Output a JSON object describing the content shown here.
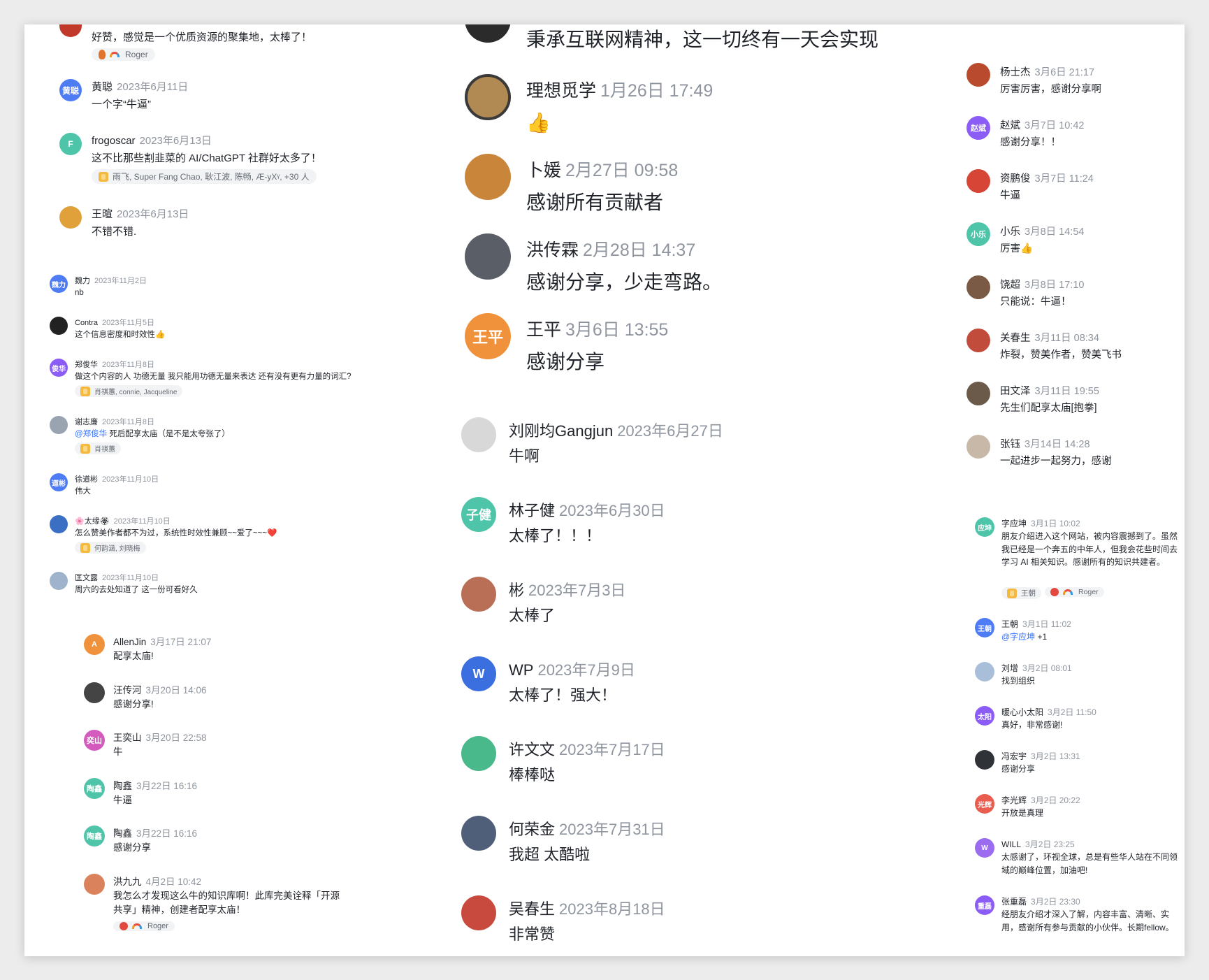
{
  "colors": {
    "blue": "#4e7cf5",
    "teal": "#4ec5a8",
    "orange": "#f0923c",
    "purple": "#8b5cf6",
    "pink": "#d45bbd",
    "red": "#e85d4e",
    "dark": "#2b2b2b",
    "mention": "#3370ff"
  },
  "left": {
    "c1": {
      "name": "",
      "date": "",
      "text": "好赞，感觉是一个优质资源的聚集地，太棒了！",
      "react": "Roger"
    },
    "c2": {
      "avatar": "黄聪",
      "name": "黄聪",
      "date": "2023年6月11日",
      "text": "一个字“牛逼”"
    },
    "c3": {
      "avatar": "F",
      "name": "frogoscar",
      "date": "2023年6月13日",
      "text": "这不比那些割韭菜的 AI/ChatGPT 社群好太多了！",
      "react": "雨飞, Super Fang Chao, 耿江波, 陈畅, Æ-yXᵞ, +30 人"
    },
    "c4": {
      "avatar": "",
      "name": "王暄",
      "date": "2023年6月13日",
      "text": "不错不错."
    },
    "d1": {
      "avatar": "魏力",
      "name": "魏力",
      "date": "2023年11月2日",
      "text": "nb"
    },
    "d2": {
      "avatar": "",
      "name": "Contra",
      "date": "2023年11月5日",
      "text": "这个信息密度和时效性"
    },
    "d3": {
      "avatar": "俊华",
      "name": "郑俊华",
      "date": "2023年11月8日",
      "text": "做这个内容的人 功德无量  我只能用功德无量来表达  还有没有更有力量的词汇?",
      "react": "肖祺蕙, connie, Jacqueline"
    },
    "d4": {
      "avatar": "",
      "name": "谢志廉",
      "date": "2023年11月8日",
      "mention": "@郑俊华",
      "text": "死后配享太庙（是不是太夸张了）",
      "react": "肖祺蕙"
    },
    "d5": {
      "avatar": "道彬",
      "name": "徐道彬",
      "date": "2023年11月10日",
      "text": "伟大"
    },
    "d6": {
      "avatar": "",
      "name": "🌸太缘🏵",
      "date": "2023年11月10日",
      "text": "怎么赞美作者都不为过，系统性时效性兼顾~~爱了~~~❤️",
      "react": "何韵涵, 刘晓梅"
    },
    "d7": {
      "avatar": "",
      "name": "匡文露",
      "date": "2023年11月10日",
      "text": "周六的去处知道了 这一份可看好久"
    },
    "e1": {
      "avatar": "A",
      "name": "AllenJin",
      "date": "3月17日 21:07",
      "text": "配享太庙!"
    },
    "e2": {
      "avatar": "",
      "name": "汪传河",
      "date": "3月20日 14:06",
      "text": "感谢分享!"
    },
    "e3": {
      "avatar": "奕山",
      "name": "王奕山",
      "date": "3月20日 22:58",
      "text": "牛"
    },
    "e4": {
      "avatar": "陶鑫",
      "name": "陶鑫",
      "date": "3月22日 16:16",
      "text": "牛逼"
    },
    "e5": {
      "avatar": "陶鑫",
      "name": "陶鑫",
      "date": "3月22日 16:16",
      "text": "感谢分享"
    },
    "e6": {
      "avatar": "",
      "name": "洪九九",
      "date": "4月2日 10:42",
      "text": "我怎么才发现这么牛的知识库啊！此库完美诠释「开源共享」精神，创建者配享太庙！",
      "react": "Roger"
    }
  },
  "mid": {
    "top_text": "秉承互联网精神，这一切终有一天会实现",
    "m1": {
      "avatar": "",
      "name": "理想觅学",
      "date": "1月26日 17:49",
      "text": "👍"
    },
    "m2": {
      "avatar": "",
      "name": "卜媛",
      "date": "2月27日 09:58",
      "text": "感谢所有贡献者"
    },
    "m3": {
      "avatar": "",
      "name": "洪传霖",
      "date": "2月28日 14:37",
      "text": "感谢分享，少走弯路。"
    },
    "m4": {
      "avatar": "王平",
      "name": "王平",
      "date": "3月6日 13:55",
      "text": "感谢分享"
    },
    "n1": {
      "avatar": "",
      "name": "刘刚均Gangjun",
      "date": "2023年6月27日",
      "text": "牛啊"
    },
    "n2": {
      "avatar": "子健",
      "name": "林子健",
      "date": "2023年6月30日",
      "text": "太棒了！！！"
    },
    "n3": {
      "avatar": "",
      "name": "彬",
      "date": "2023年7月3日",
      "text": "太棒了"
    },
    "n4": {
      "avatar": "W",
      "name": "WP",
      "date": "2023年7月9日",
      "text": "太棒了！强大！"
    },
    "n5": {
      "avatar": "",
      "name": "许文文",
      "date": "2023年7月17日",
      "text": "棒棒哒"
    },
    "n6": {
      "avatar": "",
      "name": "何荣金",
      "date": "2023年7月31日",
      "text": "我超 太酷啦"
    },
    "n7": {
      "avatar": "",
      "name": "吴春生",
      "date": "2023年8月18日",
      "text": "非常赞"
    }
  },
  "right": {
    "r1": {
      "avatar": "",
      "name": "杨士杰",
      "date": "3月6日 21:17",
      "text": "厉害厉害，感谢分享啊"
    },
    "r2": {
      "avatar": "赵斌",
      "name": "赵斌",
      "date": "3月7日 10:42",
      "text": "感谢分享！！"
    },
    "r3": {
      "avatar": "",
      "name": "资鹏俊",
      "date": "3月7日 11:24",
      "text": "牛逼"
    },
    "r4": {
      "avatar": "小乐",
      "name": "小乐",
      "date": "3月8日 14:54",
      "text": "厉害👍"
    },
    "r5": {
      "avatar": "",
      "name": "饶超",
      "date": "3月8日 17:10",
      "text": "只能说：牛逼！"
    },
    "r6": {
      "avatar": "",
      "name": "关春生",
      "date": "3月11日 08:34",
      "text": "炸裂，赞美作者，赞美飞书"
    },
    "r7": {
      "avatar": "",
      "name": "田文泽",
      "date": "3月11日 19:55",
      "text": "先生们配享太庙[抱拳]"
    },
    "r8": {
      "avatar": "",
      "name": "张钰",
      "date": "3月14日 14:28",
      "text": "一起进步一起努力，感谢"
    },
    "s1": {
      "avatar": "应坤",
      "name": "字应坤",
      "date": "3月1日 10:02",
      "text": "朋友介绍进入这个网站，被内容震撼到了。虽然我已经是一个奔五的中年人，但我会花些时间去学习 AI 相关知识。感谢所有的知识共建者。",
      "react1": "王朝",
      "react2": "Roger"
    },
    "s2": {
      "avatar": "王朝",
      "name": "王朝",
      "date": "3月1日 11:02",
      "mention": "@字应坤",
      "text": "+1"
    },
    "s3": {
      "avatar": "",
      "name": "刘增",
      "date": "3月2日 08:01",
      "text": "找到组织"
    },
    "s4": {
      "avatar": "太阳",
      "name": "暖心小太阳",
      "date": "3月2日 11:50",
      "text": "真好，非常感谢!"
    },
    "s5": {
      "avatar": "",
      "name": "冯宏宇",
      "date": "3月2日 13:31",
      "text": "感谢分享"
    },
    "s6": {
      "avatar": "光辉",
      "name": "李光辉",
      "date": "3月2日 20:22",
      "text": "开放是真理"
    },
    "s7": {
      "avatar": "W",
      "name": "WILL",
      "date": "3月2日 23:25",
      "text": "太感谢了，环视全球，总是有些华人站在不同领域的巅峰位置，加油吧!"
    },
    "s8": {
      "avatar": "重磊",
      "name": "张重磊",
      "date": "3月2日 23:30",
      "text": "经朋友介绍才深入了解，内容丰富、清晰、实用，感谢所有参与贡献的小伙伴。长期fellow。"
    }
  }
}
